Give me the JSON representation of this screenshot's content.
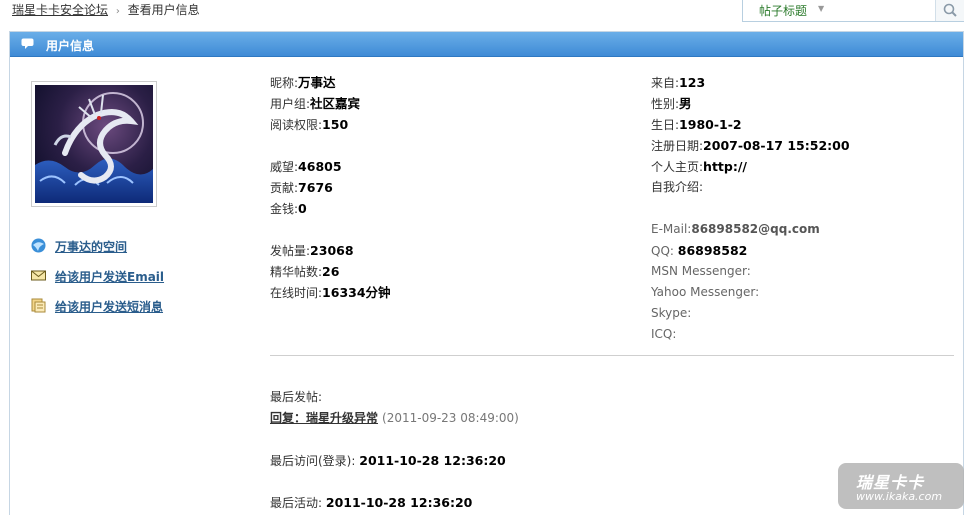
{
  "breadcrumb": {
    "home": "瑞星卡卡安全论坛",
    "separator": "›",
    "current": "查看用户信息"
  },
  "search": {
    "scope_label": "帖子标题",
    "placeholder": ""
  },
  "panel": {
    "title": "用户信息"
  },
  "links": [
    {
      "label": "万事达的空间",
      "icon": "space-icon"
    },
    {
      "label": "给该用户发送Email",
      "icon": "mail-icon"
    },
    {
      "label": "给该用户发送短消息",
      "icon": "message-icon"
    }
  ],
  "profile": {
    "nickname_label": "昵称:",
    "nickname": "万事达",
    "group_label": "用户组:",
    "group": "社区嘉宾",
    "read_label": "阅读权限:",
    "read": "150",
    "prestige_label": "威望:",
    "prestige": "46805",
    "contribution_label": "贡献:",
    "contribution": "7676",
    "money_label": "金钱:",
    "money": "0",
    "posts_label": "发帖量:",
    "posts": "23068",
    "digest_label": "精华帖数:",
    "digest": "26",
    "online_label": "在线时间:",
    "online": "16334分钟",
    "from_label": "来自:",
    "from": "123",
    "gender_label": "性别:",
    "gender": "男",
    "birthday_label": "生日:",
    "birthday": "1980-1-2",
    "register_label": "注册日期:",
    "register": "2007-08-17 15:52:00",
    "homepage_label": "个人主页:",
    "homepage": "http://",
    "intro_label": "自我介绍:",
    "email_label": "E-Mail:",
    "email": "86898582@qq.com",
    "qq_label": "QQ:",
    "qq": "86898582",
    "msn_label": "MSN Messenger:",
    "yahoo_label": "Yahoo Messenger:",
    "skype_label": "Skype:",
    "icq_label": "ICQ:"
  },
  "activity": {
    "last_post_label": "最后发帖:",
    "last_post_title": "回复：瑞星升级异常",
    "last_post_time": "(2011-09-23 08:49:00)",
    "last_visit_label": "最后访问(登录):",
    "last_visit": "2011-10-28 12:36:20",
    "last_active_label": "最后活动:",
    "last_active": "2011-10-28 12:36:20"
  },
  "watermark": {
    "line1": "瑞星卡卡",
    "line2": "www.ikaka.com"
  },
  "colors": {
    "header_blue": "#3f8bd6",
    "link_blue": "#2a5d8c",
    "scope_green": "#2c7b2c"
  }
}
